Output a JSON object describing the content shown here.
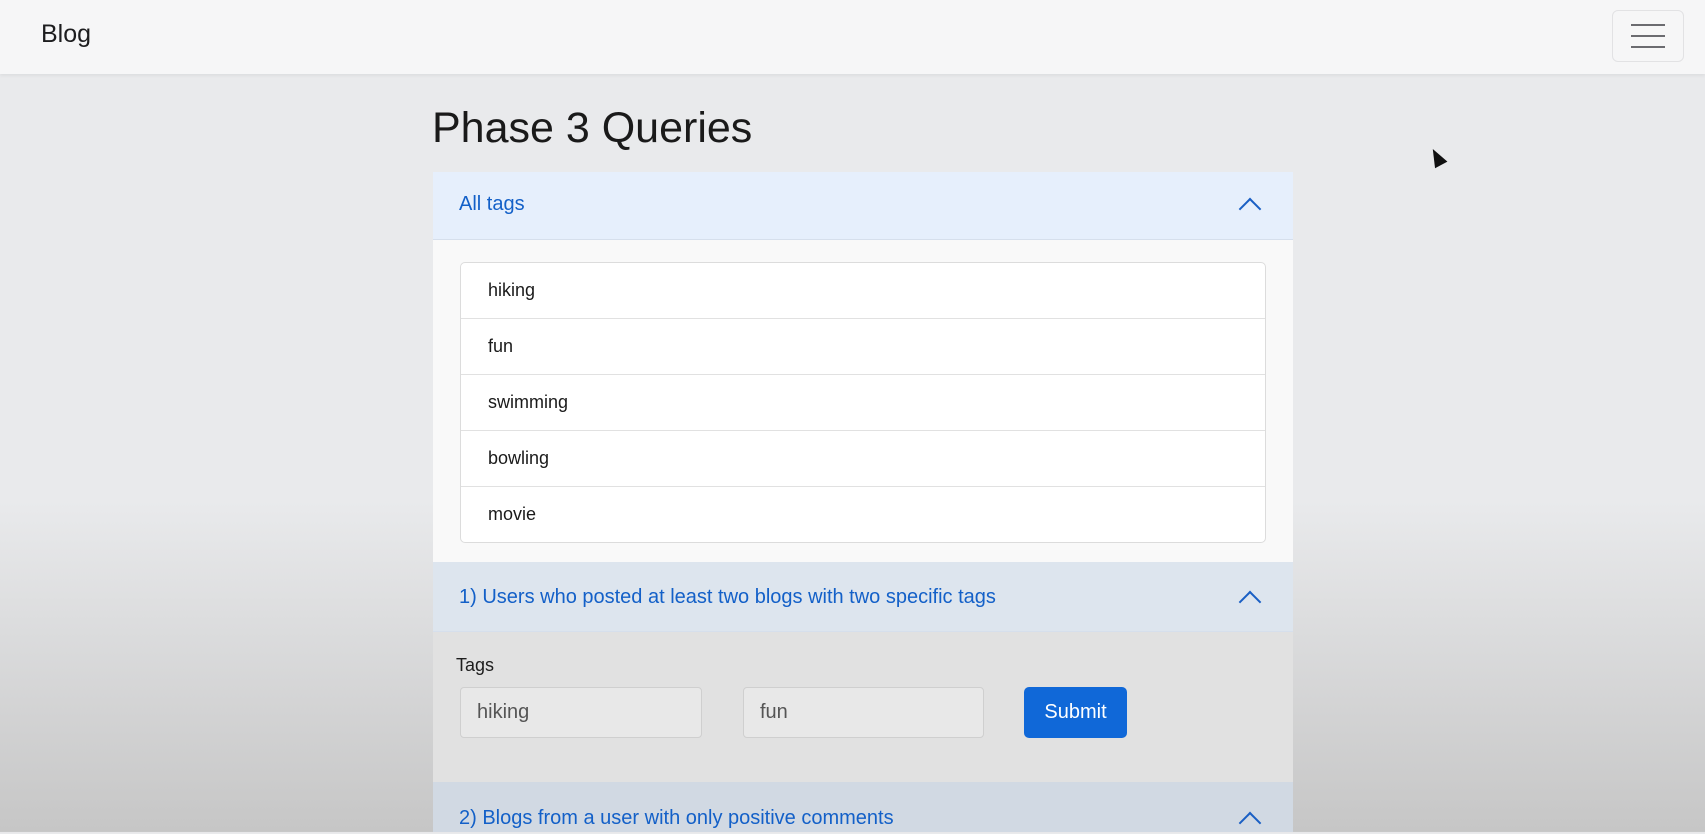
{
  "navbar": {
    "brand": "Blog",
    "toggler_icon": "hamburger-menu-icon"
  },
  "page": {
    "title": "Phase 3 Queries"
  },
  "accordion": {
    "all_tags": {
      "header": "All tags",
      "expanded": true,
      "tags": [
        "hiking",
        "fun",
        "swimming",
        "bowling",
        "movie"
      ]
    },
    "query1": {
      "header": "1) Users who posted at least two blogs with two specific tags",
      "expanded": true,
      "tags_label": "Tags",
      "tag1_value": "hiking",
      "tag2_value": "fun",
      "submit_label": "Submit"
    },
    "query2": {
      "header": "2) Blogs from a user with only positive comments",
      "expanded": true
    }
  },
  "colors": {
    "accent": "#1068d8",
    "header_text": "#1360c8",
    "header_bg": "#e6effc"
  }
}
